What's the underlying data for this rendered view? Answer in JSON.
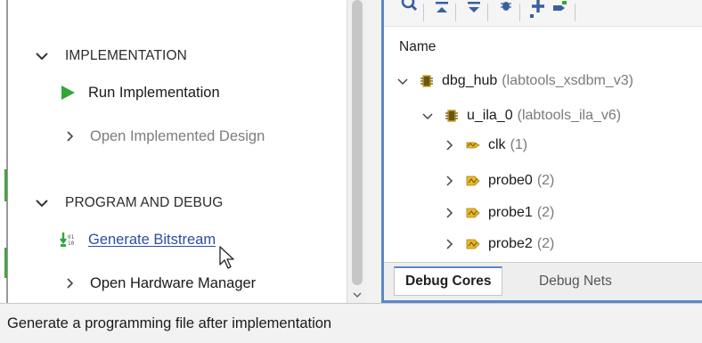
{
  "flow_navigator": {
    "implementation": {
      "header": "IMPLEMENTATION",
      "run_label": "Run Implementation",
      "open_label": "Open Implemented Design"
    },
    "program_debug": {
      "header": "PROGRAM AND DEBUG",
      "generate_label": "Generate Bitstream",
      "open_hw_label": "Open Hardware Manager"
    }
  },
  "debug_panel": {
    "column_header": "Name",
    "tree": [
      {
        "name": "dbg_hub",
        "meta": "(labtools_xsdbm_v3)",
        "icon": "chip-icon",
        "expanded": true
      },
      {
        "name": "u_ila_0",
        "meta": "(labtools_ila_v6)",
        "icon": "chip-icon",
        "expanded": true
      },
      {
        "name": "clk",
        "meta": "(1)",
        "icon": "net-icon",
        "expanded": false
      },
      {
        "name": "probe0",
        "meta": "(2)",
        "icon": "probe-icon",
        "expanded": false
      },
      {
        "name": "probe1",
        "meta": "(2)",
        "icon": "probe-icon",
        "expanded": false
      },
      {
        "name": "probe2",
        "meta": "(2)",
        "icon": "probe-icon",
        "expanded": false
      }
    ],
    "tabs": [
      "Debug Cores",
      "Debug Nets"
    ],
    "active_tab": "Debug Cores"
  },
  "status_bar": {
    "text": "Generate a programming file after implementation"
  },
  "colors": {
    "accent_blue": "#5b87c8",
    "run_green": "#2fa83a",
    "link_blue": "#2b4ea0"
  }
}
